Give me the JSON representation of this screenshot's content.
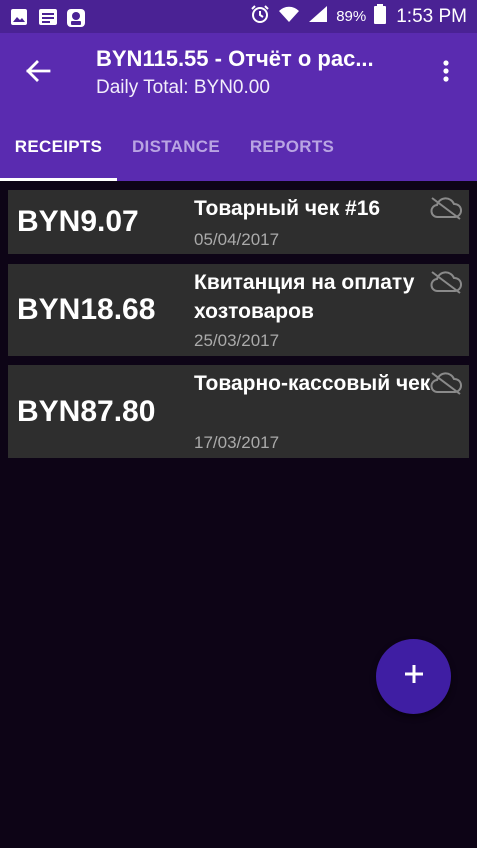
{
  "status_bar": {
    "battery_percent": "89%",
    "time": "1:53 PM",
    "left_icons": [
      "gallery-icon",
      "message-icon",
      "robot-icon"
    ],
    "right_icons": [
      "alarm-icon",
      "wifi-icon",
      "signal-icon",
      "battery-icon"
    ]
  },
  "app_bar": {
    "title": "BYN115.55 - Отчёт о рас...",
    "subtitle": "Daily Total: BYN0.00",
    "back_icon": "arrow-back-icon",
    "menu_icon": "more-vert-icon"
  },
  "tabs": [
    {
      "label": "RECEIPTS",
      "selected": true
    },
    {
      "label": "DISTANCE",
      "selected": false
    },
    {
      "label": "REPORTS",
      "selected": false
    }
  ],
  "receipts": [
    {
      "price": "BYN9.07",
      "name": "Товарный чек #16",
      "date": "05/04/2017",
      "sync_icon": "cloud-off-icon"
    },
    {
      "price": "BYN18.68",
      "name": "Квитанция на оплату хозтоваров",
      "date": "25/03/2017",
      "sync_icon": "cloud-off-icon"
    },
    {
      "price": "BYN87.80",
      "name": "Товарно-кассовый чек",
      "date": "17/03/2017",
      "sync_icon": "cloud-off-icon"
    }
  ],
  "fab": {
    "label": "+",
    "icon": "add-icon"
  },
  "colors": {
    "status_bar": "#4a2294",
    "app_bar": "#5a2bb0",
    "background": "#0d0416",
    "card": "#2e2e2e",
    "fab": "#3f1ea3",
    "tab_inactive": "#b9a4e3"
  }
}
